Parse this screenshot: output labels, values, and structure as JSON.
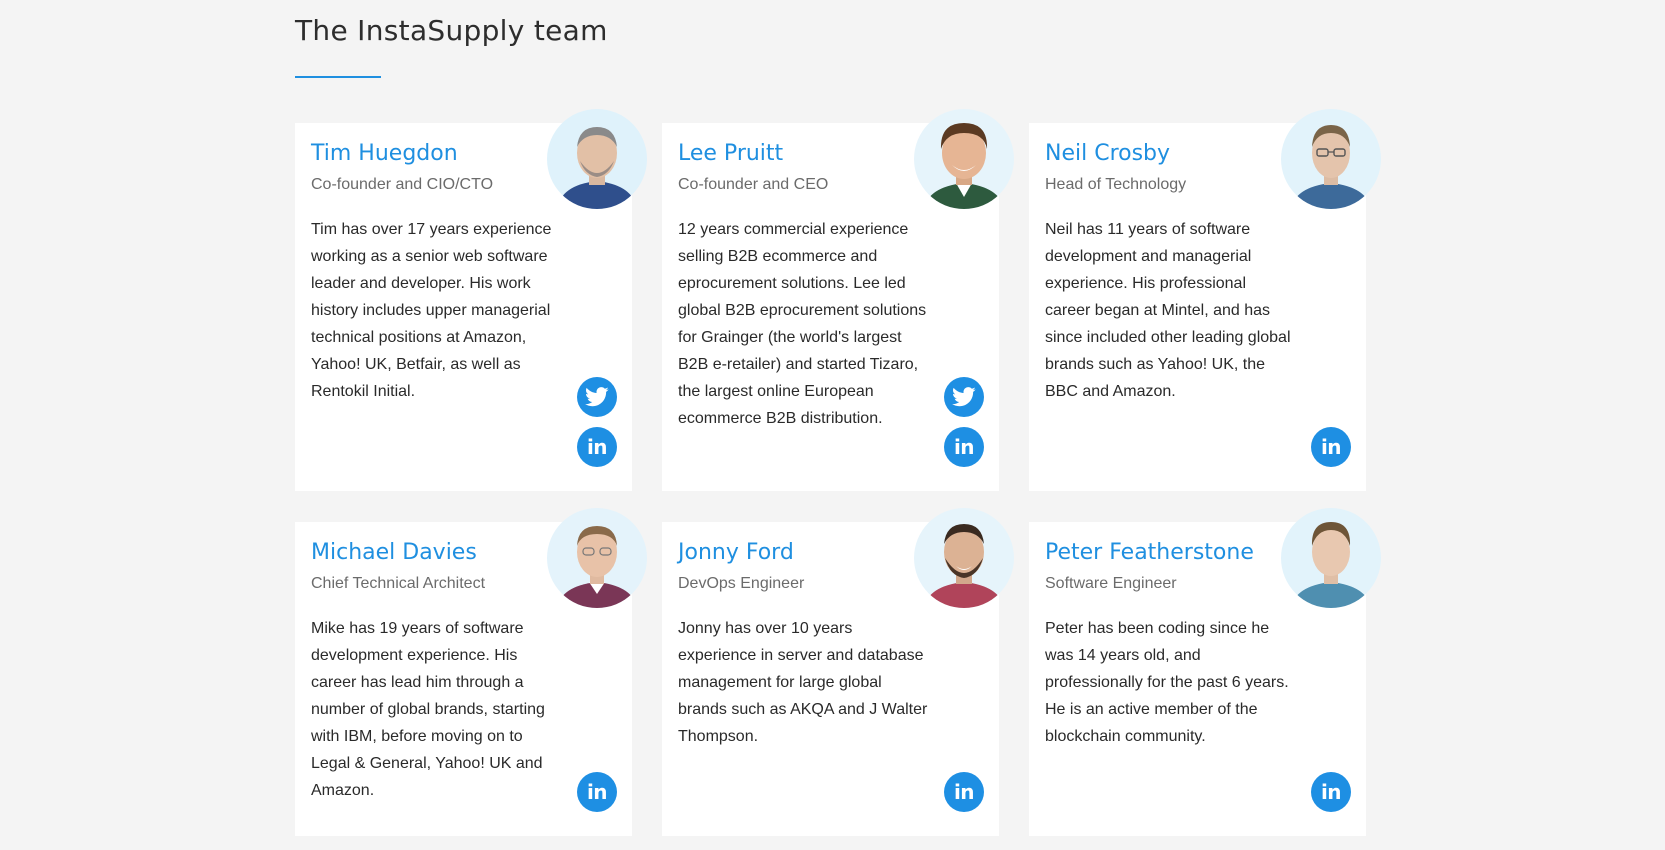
{
  "section": {
    "title": "The InstaSupply team"
  },
  "team": [
    {
      "name": "Tim Huegdon",
      "role": "Co-founder and CIO/CTO",
      "bio": "Tim has over 17 years experience working as a senior web software leader and developer. His work history includes upper managerial technical positions at Amazon, Yahoo! UK, Betfair, as well as Rentokil Initial.",
      "social": [
        "twitter-icon",
        "linkedin-icon"
      ]
    },
    {
      "name": "Lee Pruitt",
      "role": "Co-founder and CEO",
      "bio": "12 years commercial experience selling B2B ecommerce and eprocurement solutions. Lee led global B2B eprocurement solutions for Grainger (the world's largest B2B e-retailer) and started Tizaro, the largest online European ecommerce B2B distribution.",
      "social": [
        "twitter-icon",
        "linkedin-icon"
      ]
    },
    {
      "name": "Neil Crosby",
      "role": "Head of Technology",
      "bio": "Neil has 11 years of software development and managerial experience. His professional career began at Mintel, and has since included other leading global brands such as Yahoo! UK, the BBC and Amazon.",
      "social": [
        "linkedin-icon"
      ]
    },
    {
      "name": "Michael Davies",
      "role": "Chief Technical Architect",
      "bio": "Mike has 19 years of software development experience. His career has lead him through a number of global brands, starting with IBM, before moving on to Legal & General, Yahoo! UK and Amazon.",
      "social": [
        "linkedin-icon"
      ]
    },
    {
      "name": "Jonny Ford",
      "role": "DevOps Engineer",
      "bio": "Jonny has over 10 years experience in server and database management for large global brands such as AKQA and J Walter Thompson.",
      "social": [
        "linkedin-icon"
      ]
    },
    {
      "name": "Peter Featherstone",
      "role": "Software Engineer",
      "bio": "Peter has been coding since he was 14 years old, and professionally for the past 6 years. He is an active member of the blockchain community.",
      "social": [
        "linkedin-icon"
      ]
    }
  ],
  "colors": {
    "accent": "#1f8fe0",
    "social": "#1e8fe3",
    "background": "#f4f4f4",
    "card": "#ffffff"
  }
}
